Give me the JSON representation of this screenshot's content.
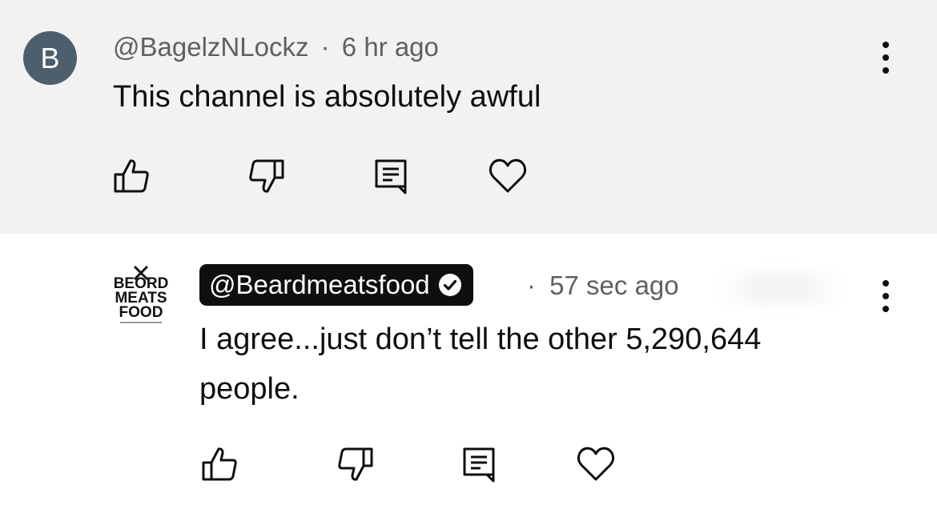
{
  "comment_1": {
    "avatar_letter": "B",
    "username": "@BagelzNLockz",
    "separator": "·",
    "time": "6 hr ago",
    "text": "This channel is absolutely awful"
  },
  "comment_2": {
    "logo_text": [
      "BEORD",
      "MEATS",
      "FOOD"
    ],
    "username": "@Beardmeatsfood",
    "verified": true,
    "separator": "·",
    "time": "57 sec ago",
    "text_line1": "I agree...just don’t tell the other 5,290,644",
    "text_line2": "people."
  },
  "icons": [
    "like-icon",
    "dislike-icon",
    "reply-icon",
    "heart-icon",
    "more-options-icon",
    "verified-check-icon"
  ],
  "colors": {
    "top_background": "#f2f2f2",
    "avatar": "#4d5e6c",
    "pill": "#0f0f0f",
    "meta_text": "#606060"
  }
}
